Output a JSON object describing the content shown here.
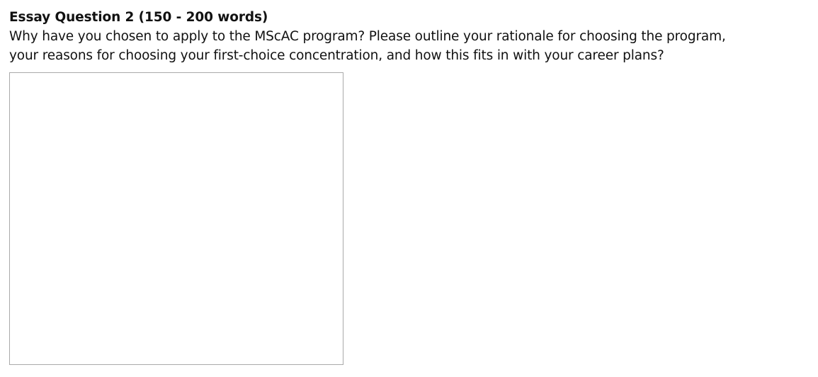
{
  "question": {
    "title": "Essay Question 2 (150 - 200 words)",
    "text": "Why have you chosen to apply to the MScAC program? Please outline your rationale for choosing the program, your reasons for choosing your first-choice concentration, and how this fits in with your career plans?"
  },
  "answer": {
    "value": "",
    "placeholder": ""
  }
}
